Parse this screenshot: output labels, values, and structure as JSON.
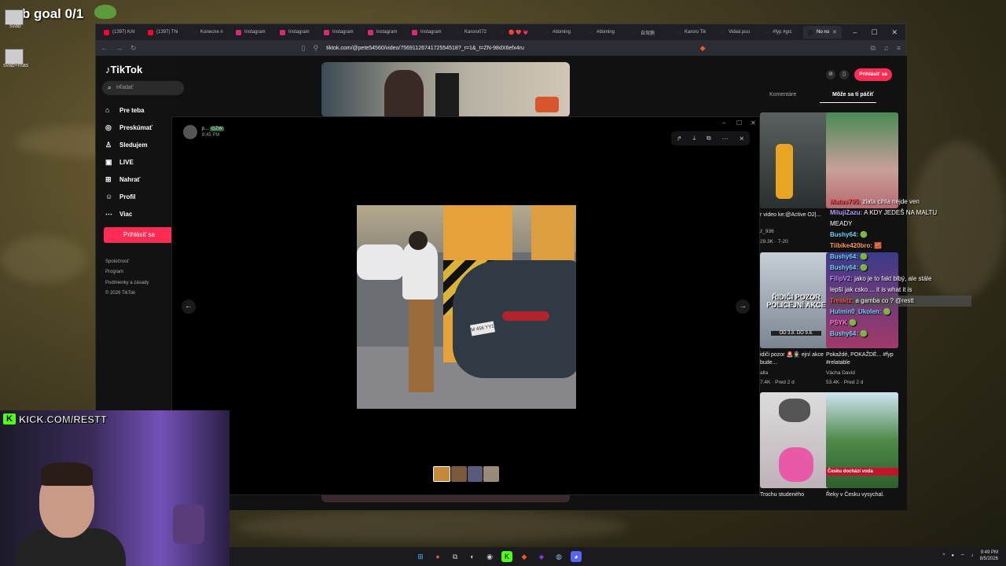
{
  "overlay": {
    "sub_goal": "sub goal 0/1",
    "desktop_icons": [
      {
        "label": "svab"
      },
      {
        "label": "svab+mas"
      }
    ],
    "kick": "KICK.COM/RESTT"
  },
  "browser": {
    "tabs": [
      {
        "title": "(1397) KAI",
        "color": "#ff0033"
      },
      {
        "title": "(1397) Thi",
        "color": "#ff0033"
      },
      {
        "title": "Konecne n",
        "color": "#222222"
      },
      {
        "title": "Instagram",
        "color": "#d62976"
      },
      {
        "title": "Instagram",
        "color": "#d62976"
      },
      {
        "title": "Instagram",
        "color": "#d62976"
      },
      {
        "title": "instagram",
        "color": "#d62976"
      },
      {
        "title": "Instagram",
        "color": "#d62976"
      },
      {
        "title": "Karoro072",
        "color": "#222222"
      },
      {
        "title": "🔴 ❤️ 💗",
        "color": "#222222"
      },
      {
        "title": "#doming",
        "color": "#222222"
      },
      {
        "title": "#doming",
        "color": "#222222"
      },
      {
        "title": "自驾鹅",
        "color": "#222222"
      },
      {
        "title": "Karoro Tik",
        "color": "#222222"
      },
      {
        "title": "Videá pou",
        "color": "#222222"
      },
      {
        "title": "#fyp #grc",
        "color": "#222222"
      },
      {
        "title": "No no",
        "color": "#222222",
        "active": true
      }
    ],
    "url": "tiktok.com/@pete54560/video/7569112674172554518?_r=1&_t=ZN-98dX6efx4ru"
  },
  "tiktok": {
    "logo": "TikTok",
    "search_placeholder": "Hľadať",
    "nav": [
      {
        "label": "Pre teba",
        "icon": "home-icon"
      },
      {
        "label": "Preskúmať",
        "icon": "compass-icon"
      },
      {
        "label": "Sledujem",
        "icon": "person-icon"
      },
      {
        "label": "LIVE",
        "icon": "live-icon"
      },
      {
        "label": "Nahrať",
        "icon": "plus-icon"
      },
      {
        "label": "Profil",
        "icon": "profile-icon"
      },
      {
        "label": "Viac",
        "icon": "more-icon"
      }
    ],
    "login_sidebar": "Prihlásiť sa",
    "footer": [
      "Spoločnosť",
      "Program",
      "Podmienky a zásady",
      "© 2026 TikTok"
    ],
    "login_top": "Prihlásiť sa",
    "right_tabs": [
      "Komentáre",
      "Môže sa ti páčiť"
    ],
    "suggestions": [
      {
        "caption": "r video ke:@Active O2|...",
        "author": "z_936",
        "views": "29.3K",
        "date": "7-20"
      },
      {
        "caption": "",
        "author": "",
        "views": "",
        "date": ""
      },
      {
        "caption": "idiči pozor 🚨👮 ejní akce bude...",
        "author": "alla",
        "views": "7.4K",
        "date": "Pred 2 d"
      },
      {
        "caption": "Pokaždé, POKAŽDÉ... #fyp #relatable",
        "author": "Vácha David",
        "views": "53.4K",
        "date": "Pred 2 d"
      },
      {
        "caption": "Trochu studeného",
        "author": "",
        "views": "",
        "date": ""
      },
      {
        "caption": "Řeky v Česku vysychal.",
        "author": "",
        "views": "",
        "date": ""
      }
    ],
    "thumb_texts": {
      "pozor": "ŘIDIČI POZOR\nPOLICEJNÍ AKCE",
      "dates": "OD 3.8. DO 9.8.",
      "voda": "Česku dochází voda"
    }
  },
  "dialog": {
    "user": "p...",
    "badge": "GZW",
    "time": "8:45 PM",
    "plate": "M 456 YY1"
  },
  "chat": [
    {
      "user": "Matus795:",
      "color": "#ff4d4d",
      "text": " zlata cihla nejde ven"
    },
    {
      "user": "MilujiZazu:",
      "color": "#b7a0ff",
      "text": " A KDY JEDEŠ NA MALTU"
    },
    {
      "user": "",
      "color": "#ffffff",
      "text": "MEADY"
    },
    {
      "user": "Bushy64:",
      "color": "#6fd7ff",
      "text": " 🟢"
    },
    {
      "user": "Tiibike420bro:",
      "color": "#ff9f43",
      "text": " 🧱"
    },
    {
      "user": "Bushy64:",
      "color": "#6fd7ff",
      "text": " 🟢"
    },
    {
      "user": "Bushy64:",
      "color": "#6fd7ff",
      "text": " 🟢"
    },
    {
      "user": "FilipV2:",
      "color": "#c88bff",
      "text": " jako je to fakt blbý, ale stále"
    },
    {
      "user": "",
      "color": "#ffffff",
      "text": "lepší jak csko.... it is what it is"
    },
    {
      "user": "Treaktz:",
      "color": "#ff4d4d",
      "text": " a gamba co ? @restt"
    },
    {
      "user": "Hulmin0_Ukolen:",
      "color": "#6fd7ff",
      "text": " 🟢"
    },
    {
      "user": "PSYK",
      "color": "#ff7cd3",
      "text": " 🟢"
    },
    {
      "user": "Bushy64:",
      "color": "#6fd7ff",
      "text": " 🟢"
    }
  ],
  "taskbar": {
    "time": "9:49 PM",
    "date": "8/5/2026"
  },
  "colors": {
    "accent": "#fe2c55",
    "kick_green": "#53fc18"
  }
}
